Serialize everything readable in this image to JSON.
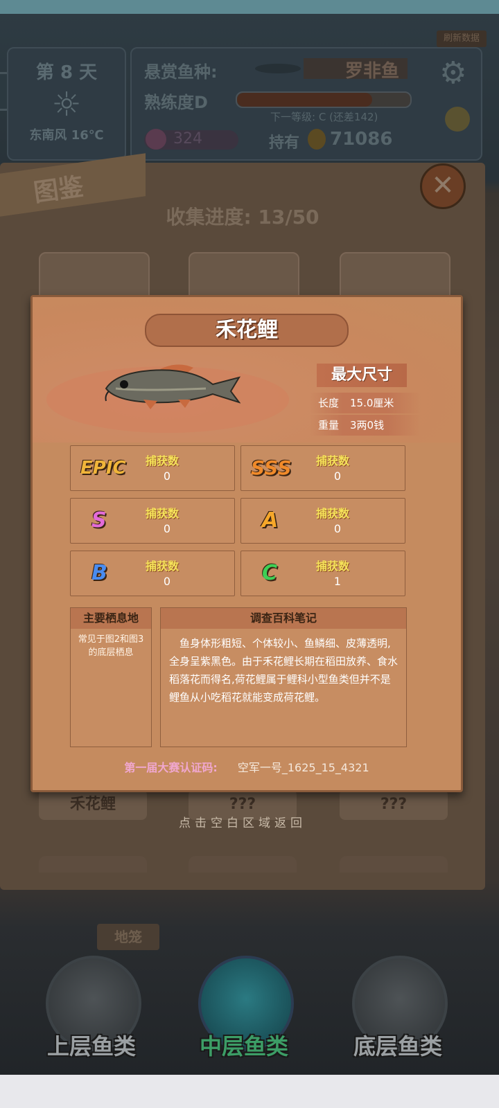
{
  "hud": {
    "day": "第 8 天",
    "wind": "东南风 16℃",
    "bounty_label": "悬赏鱼种:",
    "bounty_fish": "罗非鱼",
    "proficiency": "熟练度D",
    "next_level": "下一等级: C (还差142)",
    "pink_count": "324",
    "hold_label": "持有",
    "money": "71086",
    "refresh": "刷新数据"
  },
  "book": {
    "title": "图鉴",
    "progress": "收集进度: 13/50",
    "slot_names": [
      "禾花鲤",
      "???",
      "???"
    ],
    "hint": "点击空白区域返回"
  },
  "detail": {
    "fish_name": "禾花鲤",
    "max_size_title": "最大尺寸",
    "length_label": "长度",
    "length_value": "15.0厘米",
    "weight_label": "重量",
    "weight_value": "3两0钱",
    "grades": [
      {
        "badge": "EPIC",
        "label": "捕获数",
        "value": "0",
        "color": "#f0b53a"
      },
      {
        "badge": "SSS",
        "label": "捕获数",
        "value": "0",
        "color": "#f08a2a"
      },
      {
        "badge": "S",
        "label": "捕获数",
        "value": "0",
        "color": "#e36bd8"
      },
      {
        "badge": "A",
        "label": "捕获数",
        "value": "0",
        "color": "#f6a72a"
      },
      {
        "badge": "B",
        "label": "捕获数",
        "value": "0",
        "color": "#4a8cf0"
      },
      {
        "badge": "C",
        "label": "捕获数",
        "value": "1",
        "color": "#3ecf55"
      }
    ],
    "habitat_title": "主要栖息地",
    "habitat_text": "常见于图2和图3的底层栖息",
    "notes_title": "调查百科笔记",
    "notes_text": "鱼身体形粗短、个体较小、鱼鳞细、皮薄透明,全身呈紫黑色。由于禾花鲤长期在稻田放养、食水稻落花而得名,荷花鲤属于鲤科小型鱼类但并不是鲤鱼从小吃稻花就能变成荷花鲤。",
    "cert_label": "第一届大赛认证码:",
    "cert_value": "空军一号_1625_15_4321"
  },
  "tabs": [
    {
      "label": "上层鱼类",
      "selected": false
    },
    {
      "label": "中层鱼类",
      "selected": true
    },
    {
      "label": "底层鱼类",
      "selected": false
    }
  ],
  "cage_label": "地笼"
}
